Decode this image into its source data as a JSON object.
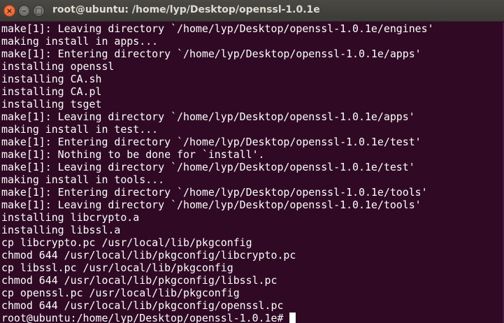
{
  "window": {
    "title": "root@ubuntu: /home/lyp/Desktop/openssl-1.0.1e",
    "close_glyph": "×",
    "minimize_glyph": "–",
    "maximize_glyph": "□"
  },
  "terminal": {
    "lines": [
      "make[1]: Leaving directory `/home/lyp/Desktop/openssl-1.0.1e/engines'",
      "making install in apps...",
      "make[1]: Entering directory `/home/lyp/Desktop/openssl-1.0.1e/apps'",
      "installing openssl",
      "installing CA.sh",
      "installing CA.pl",
      "installing tsget",
      "make[1]: Leaving directory `/home/lyp/Desktop/openssl-1.0.1e/apps'",
      "making install in test...",
      "make[1]: Entering directory `/home/lyp/Desktop/openssl-1.0.1e/test'",
      "make[1]: Nothing to be done for `install'.",
      "make[1]: Leaving directory `/home/lyp/Desktop/openssl-1.0.1e/test'",
      "making install in tools...",
      "make[1]: Entering directory `/home/lyp/Desktop/openssl-1.0.1e/tools'",
      "make[1]: Leaving directory `/home/lyp/Desktop/openssl-1.0.1e/tools'",
      "installing libcrypto.a",
      "installing libssl.a",
      "cp libcrypto.pc /usr/local/lib/pkgconfig",
      "chmod 644 /usr/local/lib/pkgconfig/libcrypto.pc",
      "cp libssl.pc /usr/local/lib/pkgconfig",
      "chmod 644 /usr/local/lib/pkgconfig/libssl.pc",
      "cp openssl.pc /usr/local/lib/pkgconfig",
      "chmod 644 /usr/local/lib/pkgconfig/openssl.pc"
    ],
    "prompt": "root@ubuntu:/home/lyp/Desktop/openssl-1.0.1e#"
  },
  "colors": {
    "background": "#300a24",
    "text": "#ffffff",
    "titlebar": "#3c3b37",
    "close_button": "#e35a1c"
  }
}
